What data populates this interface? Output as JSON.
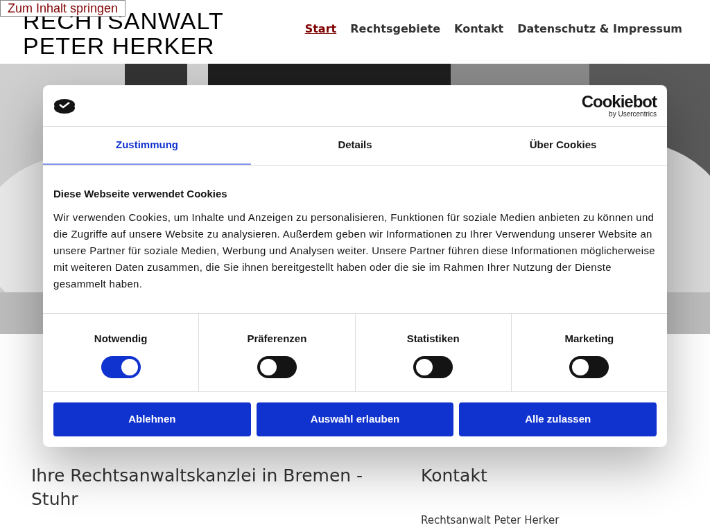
{
  "skip_link": "Zum Inhalt springen",
  "logo": [
    "RECHTSANWALT",
    "PETER HERKER"
  ],
  "nav": [
    {
      "label": "Start",
      "selected": true
    },
    {
      "label": "Rechtsgebiete",
      "selected": false
    },
    {
      "label": "Kontakt",
      "selected": false
    },
    {
      "label": "Datenschutz & Impressum",
      "selected": false
    }
  ],
  "hero": {
    "kind": "picture"
  },
  "sections": [
    {
      "title": "Ihre Rechtsanwaltskanzlei in Bremen - Stuhr"
    },
    {
      "title": "Kontakt",
      "text": "Rechtsanwalt Peter Herker"
    }
  ],
  "cookie_dialog": {
    "brand": "Cookiebot",
    "brand_sub": "by Usercentrics",
    "tabs": [
      {
        "label": "Zustimmung",
        "selected": true
      },
      {
        "label": "Details",
        "selected": false
      },
      {
        "label": "Über Cookies",
        "selected": false
      }
    ],
    "heading": "Diese Webseite verwendet Cookies",
    "body": "Wir verwenden Cookies, um Inhalte und Anzeigen zu personalisieren, Funktionen für soziale Medien anbieten zu können und die Zugriffe auf unsere Website zu analysieren. Außerdem geben wir Informationen zu Ihrer Verwendung unserer Website an unsere Partner für soziale Medien, Werbung und Analysen weiter. Unsere Partner führen diese Informationen möglicherweise mit weiteren Daten zusammen, die Sie ihnen bereitgestellt haben oder die sie im Rahmen Ihrer Nutzung der Dienste gesammelt haben.",
    "toggles": [
      {
        "label": "Notwendig",
        "on": true
      },
      {
        "label": "Präferenzen",
        "on": false
      },
      {
        "label": "Statistiken",
        "on": false
      },
      {
        "label": "Marketing",
        "on": false
      }
    ],
    "buttons": [
      "Ablehnen",
      "Auswahl erlauben",
      "Alle zulassen"
    ]
  }
}
